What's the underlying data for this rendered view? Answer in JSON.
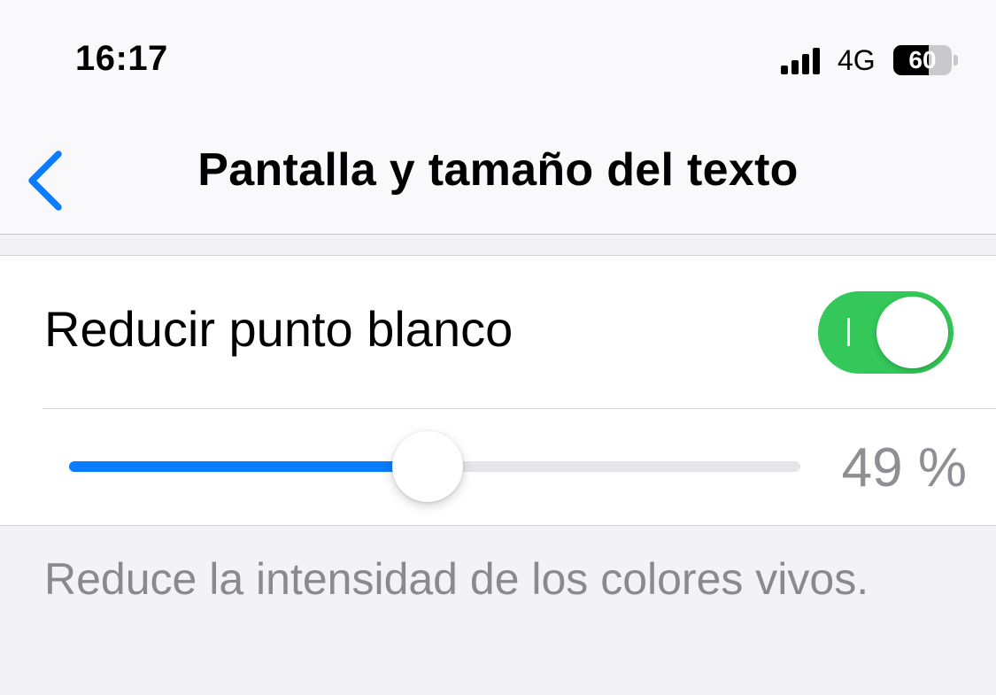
{
  "status_bar": {
    "time": "16:17",
    "network": "4G",
    "battery_percent": "60",
    "battery_level": 0.6
  },
  "nav": {
    "back_icon": "chevron-left-icon",
    "title": "Pantalla y tamaño del texto"
  },
  "setting": {
    "label": "Reducir punto blanco",
    "toggle_on": true,
    "slider_fraction": 0.49,
    "slider_value_text": "49 %"
  },
  "footer": {
    "description": "Reduce la intensidad de los colores vivos."
  },
  "colors": {
    "accent": "#0a7cff",
    "toggle_on": "#34c759",
    "secondary_text": "#8e8e93"
  }
}
